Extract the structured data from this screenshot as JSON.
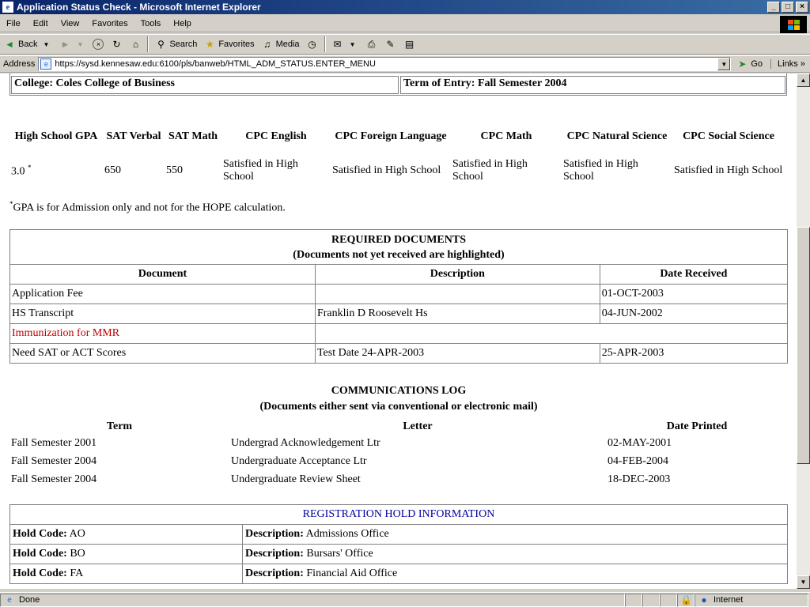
{
  "window": {
    "title": "Application Status Check - Microsoft Internet Explorer",
    "min": "_",
    "max": "□",
    "close": "×"
  },
  "menu": [
    "File",
    "Edit",
    "View",
    "Favorites",
    "Tools",
    "Help"
  ],
  "toolbar": {
    "back": "Back",
    "search": "Search",
    "favorites": "Favorites",
    "media": "Media"
  },
  "address": {
    "label": "Address",
    "url": "https://sysd.kennesaw.edu:6100/pls/banweb/HTML_ADM_STATUS.ENTER_MENU",
    "go": "Go",
    "links": "Links"
  },
  "info": {
    "college": "College: Coles College of Business",
    "term": "Term of Entry: Fall Semester 2004"
  },
  "scores": {
    "headers": [
      "High School GPA",
      "SAT Verbal",
      "SAT Math",
      "CPC English",
      "CPC Foreign Language",
      "CPC Math",
      "CPC Natural Science",
      "CPC Social Science"
    ],
    "values": [
      "3.0",
      "650",
      "550",
      "Satisfied in High School",
      "Satisfied in High School",
      "Satisfied in High School",
      "Satisfied in High School",
      "Satisfied in High School"
    ],
    "gpa_mark": "*",
    "note_mark": "*",
    "note": "GPA is for Admission only and not for the HOPE calculation."
  },
  "required_documents": {
    "title": "REQUIRED DOCUMENTS",
    "subtitle": "(Documents not yet received are highlighted)",
    "columns": [
      "Document",
      "Description",
      "Date Received"
    ],
    "rows": [
      {
        "document": "Application Fee",
        "description": "",
        "date": "01-OCT-2003"
      },
      {
        "document": "HS Transcript",
        "description": "Franklin D Roosevelt Hs",
        "date": "04-JUN-2002"
      },
      {
        "document": "Immunization for MMR",
        "description": "",
        "date": ""
      },
      {
        "document": "Need SAT or ACT Scores",
        "description": "Test Date 24-APR-2003",
        "date": "25-APR-2003"
      }
    ]
  },
  "communications": {
    "title": "COMMUNICATIONS LOG",
    "subtitle": "(Documents either sent via conventional or electronic mail)",
    "columns": [
      "Term",
      "Letter",
      "Date Printed"
    ],
    "rows": [
      {
        "term": "Fall Semester 2001",
        "letter": "Undergrad Acknowledgement Ltr",
        "date": "02-MAY-2001"
      },
      {
        "term": "Fall Semester 2004",
        "letter": "Undergraduate Acceptance Ltr",
        "date": "04-FEB-2004"
      },
      {
        "term": "Fall Semester 2004",
        "letter": "Undergraduate Review Sheet",
        "date": "18-DEC-2003"
      }
    ]
  },
  "holds": {
    "title": "REGISTRATION HOLD INFORMATION",
    "code_label": "Hold Code:",
    "desc_label": "Description:",
    "rows": [
      {
        "code": "AO",
        "description": "Admissions Office"
      },
      {
        "code": "BO",
        "description": "Bursars' Office"
      },
      {
        "code": "FA",
        "description": "Financial Aid Office"
      }
    ]
  },
  "status": {
    "text": "Done",
    "zone": "Internet"
  }
}
